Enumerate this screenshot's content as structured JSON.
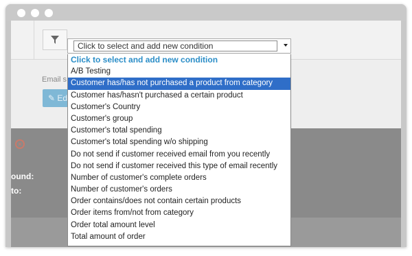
{
  "window": {
    "controls": [
      "close",
      "minimize",
      "maximize"
    ]
  },
  "toolbar": {
    "filter_icon": "filter-icon"
  },
  "background": {
    "email_label": "Email s",
    "edit_button_label": "Ed",
    "found_label": "ound:",
    "to_label": "to:",
    "status_icon": "cancel-circle-icon"
  },
  "select": {
    "current_value": "Click to select and add new condition"
  },
  "dropdown": {
    "header": "Click to select and add new condition",
    "selected_index": 1,
    "options": [
      "A/B Testing",
      "Customer has/has not purchased a product from category",
      "Customer has/hasn't purchased a certain product",
      "Customer's Country",
      "Customer's group",
      "Customer's total spending",
      "Customer's total spending w/o shipping",
      "Do not send if customer received email from you recently",
      "Do not send if customer received this type of email recently",
      "Number of customer's complete orders",
      "Number of customer's orders",
      "Order contains/does not contain certain products",
      "Order items from/not from category",
      "Order total amount level",
      "Total amount of order"
    ]
  },
  "colors": {
    "selected_bg": "#2f6ec8",
    "header_text": "#2a8dc7",
    "edit_button": "#7fb8d6"
  }
}
